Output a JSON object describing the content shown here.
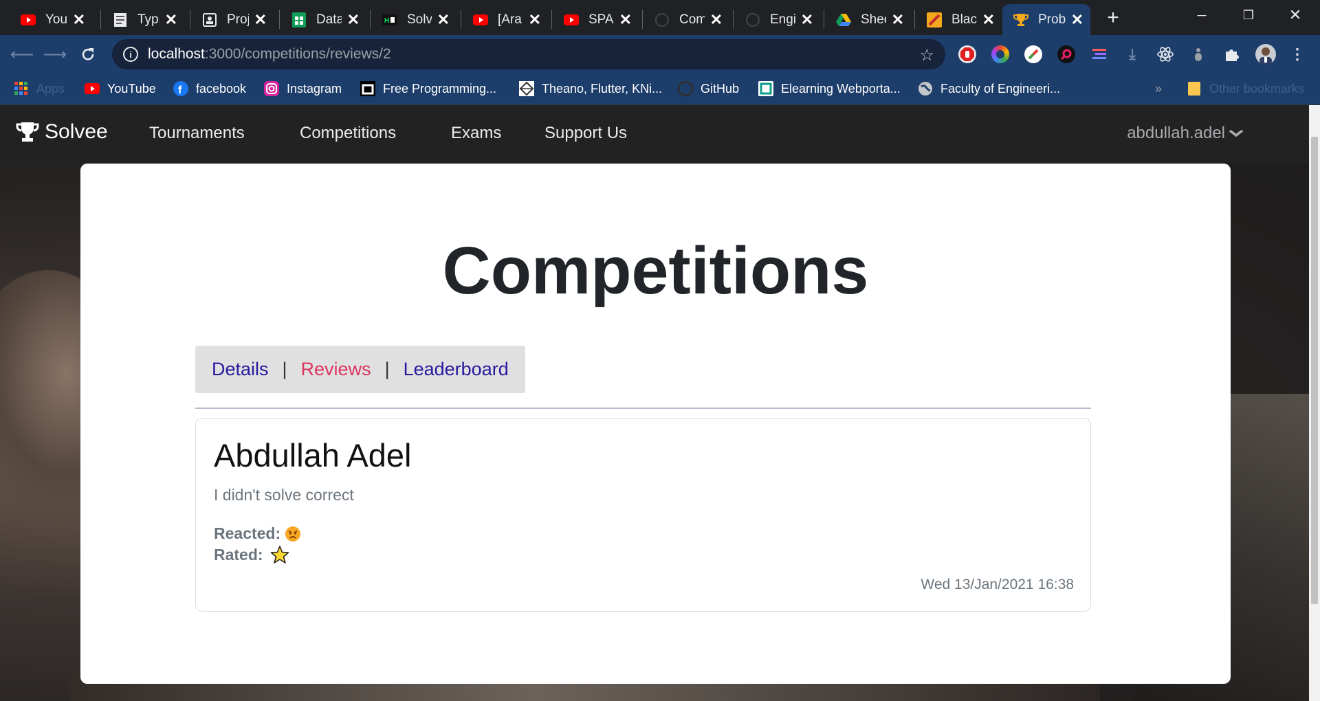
{
  "browser": {
    "tabs": [
      {
        "title": "YouT",
        "favicon": "youtube-icon",
        "active": false
      },
      {
        "title": "Typir",
        "favicon": "typing-icon",
        "active": false
      },
      {
        "title": "Proje",
        "favicon": "project-icon",
        "active": false
      },
      {
        "title": "Data",
        "favicon": "sheets-icon",
        "active": false
      },
      {
        "title": "Solv",
        "favicon": "hackerrank-icon",
        "active": false
      },
      {
        "title": "[Ara",
        "favicon": "youtube-icon",
        "active": false
      },
      {
        "title": "SPA",
        "favicon": "youtube-icon",
        "active": false
      },
      {
        "title": "Com",
        "favicon": "github-icon",
        "active": false
      },
      {
        "title": "Engi",
        "favicon": "github-icon",
        "active": false
      },
      {
        "title": "Shee",
        "favicon": "drive-icon",
        "active": false
      },
      {
        "title": "Blacl",
        "favicon": "blackboard-icon",
        "active": false
      },
      {
        "title": "Prob",
        "favicon": "trophy-icon",
        "active": true
      }
    ],
    "url_host": "localhost",
    "url_path": ":3000/competitions/reviews/2",
    "bookmarks": [
      {
        "label": "Apps",
        "icon": "apps-grid-icon",
        "faded": true
      },
      {
        "label": "YouTube",
        "icon": "youtube-icon"
      },
      {
        "label": "facebook",
        "icon": "facebook-icon"
      },
      {
        "label": "Instagram",
        "icon": "instagram-icon"
      },
      {
        "label": "Free Programming...",
        "icon": "bookmark-page-icon"
      },
      {
        "label": "Theano, Flutter, KNi...",
        "icon": "bookmark-diamond-icon"
      },
      {
        "label": "GitHub",
        "icon": "github-icon"
      },
      {
        "label": "Elearning Webporta...",
        "icon": "elearning-icon"
      },
      {
        "label": "Faculty of Engineeri...",
        "icon": "globe-icon"
      }
    ],
    "bookmarks_overflow": "»",
    "other_bookmarks": "Other bookmarks"
  },
  "app": {
    "brand": "Solvee",
    "nav": [
      "Tournaments",
      "Competitions",
      "Exams",
      "Support Us"
    ],
    "user": "abdullah.adel"
  },
  "page": {
    "title": "Competitions",
    "subnav": {
      "details": "Details",
      "reviews": "Reviews",
      "leaderboard": "Leaderboard",
      "separator": "|",
      "active": "Reviews"
    },
    "review": {
      "author": "Abdullah Adel",
      "text": "I didn't solve correct",
      "reacted_label": "Reacted:",
      "reaction_icon": "angry-face-icon",
      "rated_label": "Rated:",
      "rating_icon": "star-icon",
      "date": "Wed 13/Jan/2021 16:38"
    }
  },
  "colors": {
    "app_nav_bg": "#222222",
    "link": "#2718a0",
    "active_link": "#dc3560",
    "browser_toolbar": "#1d3e6b"
  }
}
